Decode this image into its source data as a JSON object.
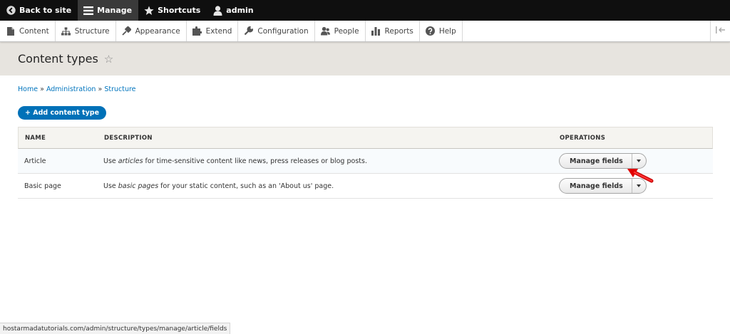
{
  "toolbar": {
    "back_label": "Back to site",
    "manage_label": "Manage",
    "shortcuts_label": "Shortcuts",
    "user_label": "admin"
  },
  "tray": {
    "items": [
      {
        "label": "Content",
        "icon": "file-icon"
      },
      {
        "label": "Structure",
        "icon": "sitemap-icon"
      },
      {
        "label": "Appearance",
        "icon": "brush-icon"
      },
      {
        "label": "Extend",
        "icon": "puzzle-icon"
      },
      {
        "label": "Configuration",
        "icon": "wrench-icon"
      },
      {
        "label": "People",
        "icon": "people-icon"
      },
      {
        "label": "Reports",
        "icon": "bar-chart-icon"
      },
      {
        "label": "Help",
        "icon": "help-icon"
      }
    ]
  },
  "page": {
    "title": "Content types",
    "breadcrumb": [
      "Home",
      "Administration",
      "Structure"
    ],
    "breadcrumb_sep": "»",
    "add_button": "+ Add content type"
  },
  "table": {
    "headers": [
      "NAME",
      "DESCRIPTION",
      "OPERATIONS"
    ],
    "rows": [
      {
        "name": "Article",
        "desc_pre": "Use ",
        "desc_em": "articles",
        "desc_post": " for time-sensitive content like news, press releases or blog posts.",
        "op": "Manage fields"
      },
      {
        "name": "Basic page",
        "desc_pre": "Use ",
        "desc_em": "basic pages",
        "desc_post": " for your static content, such as an 'About us' page.",
        "op": "Manage fields"
      }
    ]
  },
  "statusbar": {
    "url": "hostarmadatutorials.com/admin/structure/types/manage/article/fields"
  },
  "colors": {
    "toolbar_bg": "#0f0f0f",
    "link": "#0074bd",
    "primary_button": "#0071b8",
    "annotation_arrow": "#e00000"
  }
}
